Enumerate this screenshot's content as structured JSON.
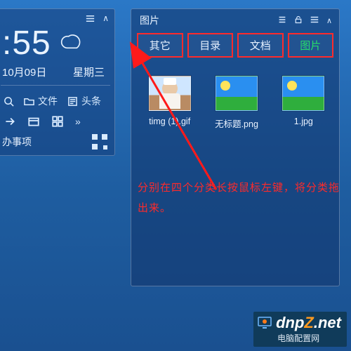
{
  "widget": {
    "time_display": ":55",
    "date": "10月09日",
    "weekday": "星期三",
    "row1": {
      "search_label": "",
      "files_label": "文件",
      "headlines_label": "头条"
    },
    "todo_label": "办事项"
  },
  "panel": {
    "title": "图片",
    "tabs": [
      {
        "label": "其它",
        "active": false
      },
      {
        "label": "目录",
        "active": false
      },
      {
        "label": "文档",
        "active": false
      },
      {
        "label": "图片",
        "active": true
      }
    ],
    "files": [
      {
        "name": "timg (1).gif",
        "kind": "photo-person"
      },
      {
        "name": "无标题.png",
        "kind": "landscape"
      },
      {
        "name": "1.jpg",
        "kind": "landscape"
      }
    ]
  },
  "annotation": {
    "line1": "分别在四个分类长按鼠标左键，将分类拖",
    "line2": "出来。"
  },
  "watermark": {
    "brand": "dnp",
    "z": "Z",
    "domain": ".net",
    "cn": "电脑配置网"
  }
}
